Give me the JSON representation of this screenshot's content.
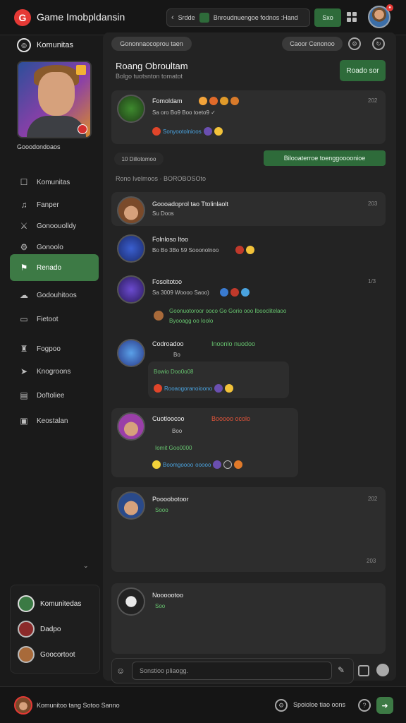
{
  "topbar": {
    "logo_glyph": "G",
    "app_title": "Game Imobpldansin",
    "search_label": "Srdde",
    "search_text": "Bnroudnuengoe fodnos :Hand",
    "btn_label": "Sxo"
  },
  "sidebar": {
    "header": "Komunitas",
    "profile_name": "Gooodondoaos",
    "nav": [
      {
        "label": "Komunitas",
        "icon": "chat-bubble-icon"
      },
      {
        "label": "Fanper",
        "icon": "music-note-icon"
      },
      {
        "label": "Gonoouolldy",
        "icon": "sword-icon"
      },
      {
        "label": "Gonoolo",
        "icon": "cog-icon"
      },
      {
        "label": "Renado",
        "icon": "flag-icon",
        "active": true
      },
      {
        "label": "Godouhitoos",
        "icon": "cloud-icon"
      },
      {
        "label": "Fietoot",
        "icon": "gamepad-icon"
      },
      {
        "label": "Fogpoo",
        "icon": "trophy-icon"
      },
      {
        "label": "Knogroons",
        "icon": "cursor-icon"
      },
      {
        "label": "Doftoliee",
        "icon": "folder-icon"
      },
      {
        "label": "Keostalan",
        "icon": "document-icon"
      }
    ],
    "chevron": "⌄",
    "bottom": [
      {
        "label": "Komunitedas"
      },
      {
        "label": "Dadpo"
      },
      {
        "label": "Goocortoot"
      }
    ]
  },
  "main": {
    "chip_left": "Gononnaocoprou taen",
    "chip_right": "Caoor Cenonoo",
    "room_title": "Roang Obroultam",
    "room_sub": "Bolgo tuotsnton tomatot",
    "join_label": "Roado sor",
    "separator_chip": "10 Dillotomoo",
    "separator_btn": "Bilooaterroe toenggoooonioe",
    "section_label": "Rono Ivelmoos · BOROBOSOto",
    "messages": [
      {
        "name": "Fomoldam",
        "time": "202",
        "line1": "Sa oro Bo9 Boo toeto9 ✓",
        "line2": "Sonyootolnioos"
      },
      {
        "name": "Goooadoprol tao Ttolinlaolt",
        "time": "203",
        "line1": "Su Doos"
      },
      {
        "name": "Folnloso ltoo",
        "line1": "Bo Bo 3Bo 59 Sooonolnoo"
      },
      {
        "name": "Fosoltotoo",
        "time": "1/3",
        "line1": "Sa 3009 Woooo Saoo)",
        "quote": "Goonuotoroor ooco Go Gorio ooo Ibooclitelaoo",
        "quote2": "Byooagg oo Ioolo"
      },
      {
        "name": "Codroadoo",
        "tag": "Inoonlo nuodoo",
        "line1": "Bo",
        "line2": "Bowio Doo0o08",
        "line3": "Rooaogoranoioono"
      },
      {
        "name": "Cuotloocoo",
        "tag": "Booooo ocolo",
        "line1": "Boo",
        "line2": "Iomit Goo0000",
        "line3": "Boomgoooo",
        "line3b": "ooooo"
      },
      {
        "name": "Poooobotoor",
        "time": "202",
        "line1": "Sooo",
        "time2": "203"
      },
      {
        "name": "Noooootoo",
        "line1": "Soo"
      }
    ],
    "composer_placeholder": "Sonstioo pliaogg."
  },
  "bottombar": {
    "left_text": "Komunitoo tang Sotoo Sanno",
    "right_text": "Spoioloe tiao oons",
    "send_glyph": "➜"
  },
  "colors": {
    "accent_green": "#3d7a45",
    "brand_red": "#e53935",
    "panel": "#2d2d2d"
  }
}
